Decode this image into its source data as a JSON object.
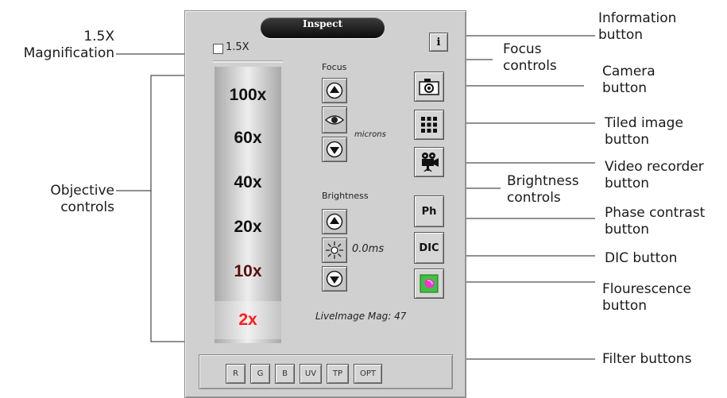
{
  "panel": {
    "title": "Inspect",
    "magnification_checkbox_label": "1.5X",
    "focus_label": "Focus",
    "focus_unit": "microns",
    "brightness_label": "Brightness",
    "brightness_value": "0.0ms",
    "live_image_mag": "LiveImage Mag: 47",
    "info_button": "i",
    "objectives": [
      "100x",
      "60x",
      "40x",
      "20x",
      "10x",
      "2x"
    ],
    "selected_objective": "2x",
    "contrast_buttons": [
      "Ph",
      "DIC"
    ],
    "filters": [
      "R",
      "G",
      "B",
      "UV",
      "TP",
      "OPT"
    ]
  },
  "callouts": {
    "magnification": "1.5X Magnification",
    "objective_controls": "Objective controls",
    "information_button": "Information button",
    "focus_controls": "Focus controls",
    "camera_button": "Camera button",
    "tiled_image_button": "Tiled image button",
    "video_recorder_button": "Video recorder button",
    "brightness_controls": "Brightness controls",
    "phase_contrast_button": "Phase contrast button",
    "dic_button": "DIC button",
    "fluorescence_button": "Flourescence button",
    "filter_buttons": "Filter buttons"
  },
  "icons": {
    "focus_up": "up-arrow-icon",
    "focus_eye": "eye-icon",
    "focus_down": "down-arrow-icon",
    "brightness_up": "up-arrow-icon",
    "brightness_sun": "sun-icon",
    "brightness_down": "down-arrow-icon",
    "camera": "camera-icon",
    "tiled": "grid-icon",
    "video": "video-camera-icon",
    "fluorescence": "fluorescence-icon"
  },
  "colors": {
    "selected_objective_text": "#ff1c1c",
    "title_pill": "#111111",
    "fluorescence_pink": "#e83ac8",
    "fluorescence_green": "#3cc43c"
  }
}
